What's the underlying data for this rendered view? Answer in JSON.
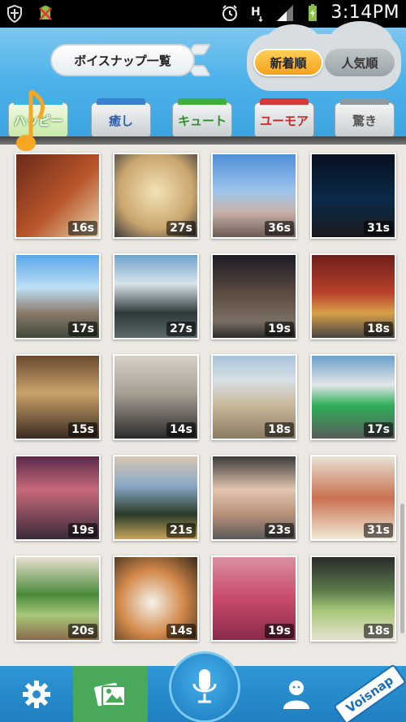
{
  "status_bar": {
    "time": "3:14PM"
  },
  "header": {
    "title": "ボイスナップ一覧",
    "sort": {
      "newest": "新着順",
      "popular": "人気順"
    }
  },
  "tabs": [
    {
      "label": "ハッピー"
    },
    {
      "label": "癒し"
    },
    {
      "label": "キュート"
    },
    {
      "label": "ユーモア"
    },
    {
      "label": "驚き"
    }
  ],
  "grid": {
    "rows": [
      [
        {
          "duration": "16s"
        },
        {
          "duration": "27s"
        },
        {
          "duration": "36s"
        },
        {
          "duration": "31s"
        }
      ],
      [
        {
          "duration": "17s"
        },
        {
          "duration": "27s"
        },
        {
          "duration": "19s"
        },
        {
          "duration": "18s"
        }
      ],
      [
        {
          "duration": "15s"
        },
        {
          "duration": "14s"
        },
        {
          "duration": "18s"
        },
        {
          "duration": "17s"
        }
      ],
      [
        {
          "duration": "19s"
        },
        {
          "duration": "21s"
        },
        {
          "duration": "23s"
        },
        {
          "duration": "31s"
        }
      ],
      [
        {
          "duration": "20s"
        },
        {
          "duration": "14s"
        },
        {
          "duration": "19s"
        },
        {
          "duration": "18s"
        }
      ]
    ]
  },
  "bottom_nav": {
    "brand": "Voisnap"
  },
  "colors": {
    "header_sky": "#4fb3ea",
    "tab_active": "#4aa85a",
    "nav_blue": "#1f7fbf",
    "sort_active": "#f3a21d"
  }
}
